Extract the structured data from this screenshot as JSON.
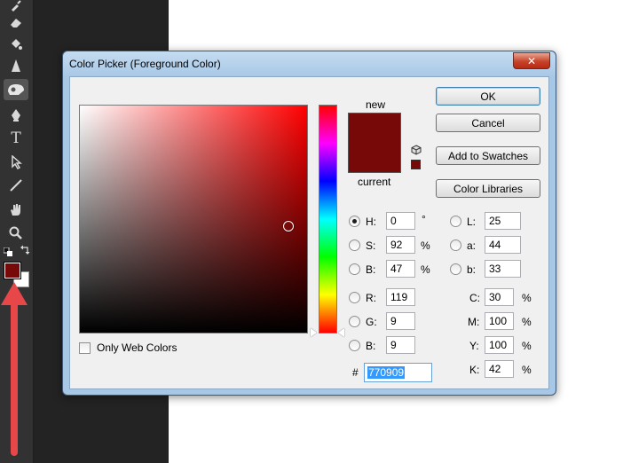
{
  "dialog": {
    "title": "Color Picker (Foreground Color)",
    "close_glyph": "✕",
    "new_label": "new",
    "current_label": "current",
    "new_color": "#770909",
    "current_color": "#770909",
    "warn_color": "#770909",
    "buttons": {
      "ok": "OK",
      "cancel": "Cancel",
      "add_swatches": "Add to Swatches",
      "color_libraries": "Color Libraries"
    },
    "only_web_colors": "Only Web Colors",
    "hsb": {
      "h_label": "H:",
      "h_value": "0",
      "h_unit": "°",
      "s_label": "S:",
      "s_value": "92",
      "s_unit": "%",
      "b_label": "B:",
      "b_value": "47",
      "b_unit": "%"
    },
    "rgb": {
      "r_label": "R:",
      "r_value": "119",
      "g_label": "G:",
      "g_value": "9",
      "b_label": "B:",
      "b_value": "9"
    },
    "lab": {
      "l_label": "L:",
      "l_value": "25",
      "a_label": "a:",
      "a_value": "44",
      "b_label": "b:",
      "b_value": "33"
    },
    "cmyk": {
      "c_label": "C:",
      "c_value": "30",
      "c_unit": "%",
      "m_label": "M:",
      "m_value": "100",
      "m_unit": "%",
      "y_label": "Y:",
      "y_value": "100",
      "y_unit": "%",
      "k_label": "K:",
      "k_value": "42",
      "k_unit": "%"
    },
    "hex_label": "#",
    "hex_value": "770909",
    "selected_mode": "H"
  },
  "toolbar": {
    "tools": [
      "smudge-icon",
      "eraser-icon",
      "paint-bucket-icon",
      "sharpen-icon",
      "blur-icon",
      "pen-icon",
      "type-icon",
      "path-selection-icon",
      "line-icon",
      "hand-icon",
      "zoom-icon"
    ],
    "active_tool": "blur-icon",
    "type_glyph": "T",
    "foreground_color": "#770909",
    "background_color": "#ffffff"
  },
  "colors": {
    "arrow": "#e8474a"
  }
}
